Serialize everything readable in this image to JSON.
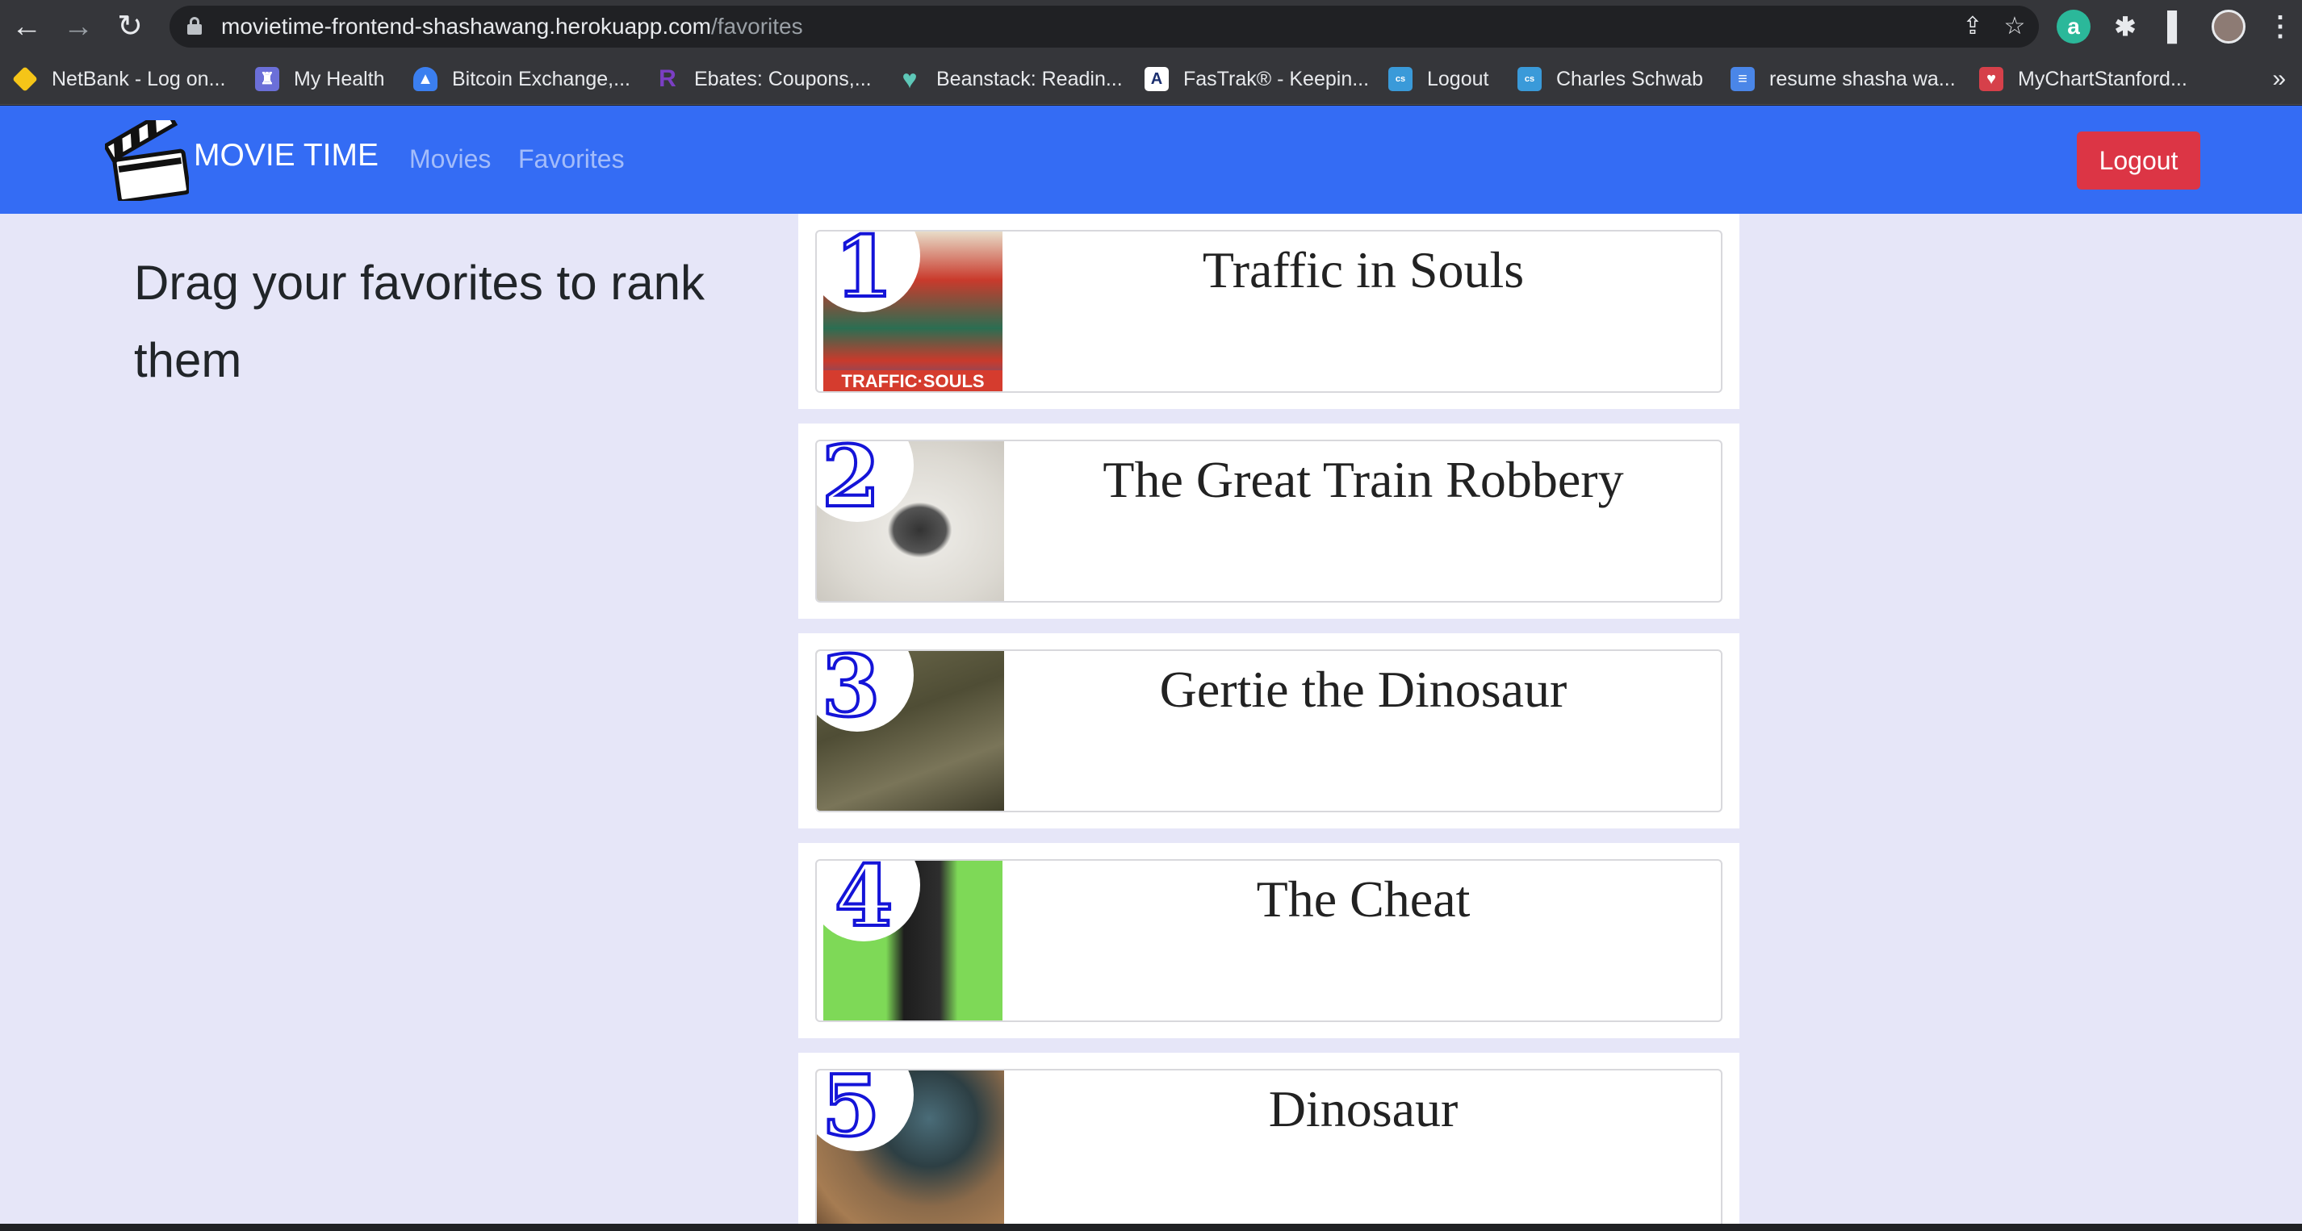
{
  "browser": {
    "url_host": "movietime-frontend-shashawang.herokuapp.com",
    "url_path": "/favorites",
    "bookmarks": [
      {
        "label": "NetBank - Log on...",
        "icon": "diamond-icon",
        "color": "#f5c518"
      },
      {
        "label": "My Health",
        "icon": "health-icon",
        "color": "#6b6fd8"
      },
      {
        "label": "Bitcoin Exchange,...",
        "icon": "triangle-icon",
        "color": "#3b7ff0"
      },
      {
        "label": "Ebates: Coupons,...",
        "icon": "r-letter-icon",
        "color": "#7b3fc4"
      },
      {
        "label": "Beanstack: Readin...",
        "icon": "heart-icon",
        "color": "#5ec8b8"
      },
      {
        "label": "FasTrak® - Keepin...",
        "icon": "fastrak-icon",
        "color": "#ffffff"
      },
      {
        "label": "Logout",
        "icon": "schwab-icon",
        "color": "#3a9ad9"
      },
      {
        "label": "Charles Schwab",
        "icon": "schwab-icon",
        "color": "#3a9ad9"
      },
      {
        "label": "resume shasha wa...",
        "icon": "doc-icon",
        "color": "#4a86e8"
      },
      {
        "label": "MyChartStanford...",
        "icon": "mychart-icon",
        "color": "#d6404a"
      }
    ]
  },
  "app": {
    "brand": "MOVIE TIME",
    "nav": {
      "movies": "Movies",
      "favorites": "Favorites"
    },
    "logout": "Logout",
    "heading": "Drag your favorites to rank them",
    "accent": "#346cf4",
    "danger": "#dc3545",
    "favorites": [
      {
        "rank": "1",
        "title": "Traffic in Souls"
      },
      {
        "rank": "2",
        "title": "The Great Train Robbery"
      },
      {
        "rank": "3",
        "title": "Gertie the Dinosaur"
      },
      {
        "rank": "4",
        "title": "The Cheat"
      },
      {
        "rank": "5",
        "title": "Dinosaur"
      }
    ]
  }
}
